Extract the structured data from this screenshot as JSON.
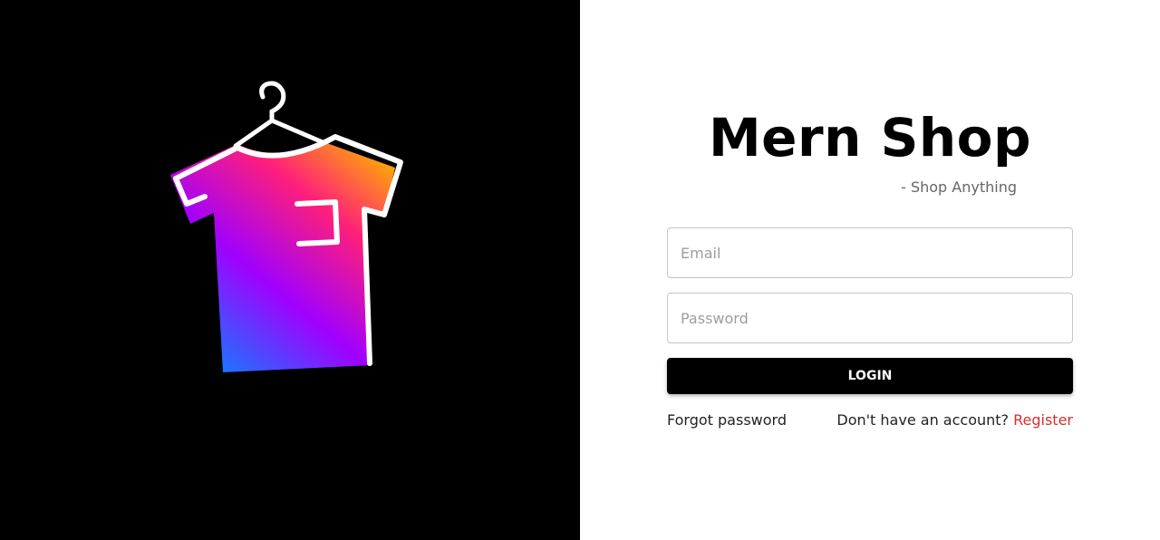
{
  "brand": {
    "title": "Mern Shop",
    "tagline": "- Shop Anything"
  },
  "form": {
    "email_placeholder": "Email",
    "password_placeholder": "Password",
    "login_label": "LOGIN"
  },
  "links": {
    "forgot_password": "Forgot password",
    "no_account_text": "Don't have an account?",
    "register": "Register"
  },
  "colors": {
    "left_panel_bg": "#000000",
    "button_bg": "#000000",
    "register_link": "#d32f2f"
  },
  "icons": {
    "logo": "tshirt-hanger-icon"
  }
}
